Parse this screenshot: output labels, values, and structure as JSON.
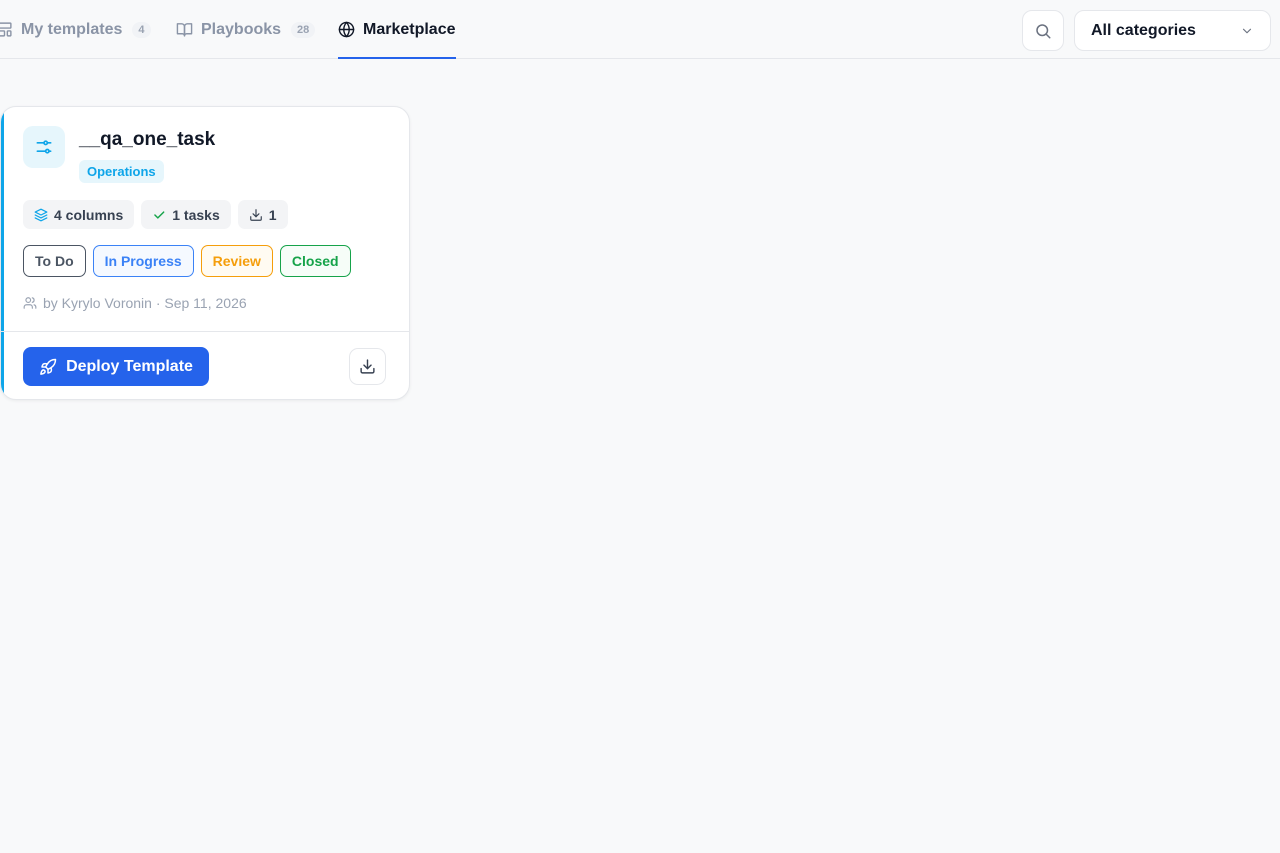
{
  "tabs": [
    {
      "label": "My templates",
      "count": "4",
      "icon": "layout-template-icon"
    },
    {
      "label": "Playbooks",
      "count": "28",
      "icon": "book-open-icon"
    },
    {
      "label": "Marketplace",
      "icon": "globe-icon",
      "active": true
    }
  ],
  "toolbar": {
    "search_icon": "search-icon",
    "category_select": {
      "value": "All categories",
      "icon": "chevron-down-icon"
    }
  },
  "card": {
    "title": "__qa_one_task",
    "icon": "sliders-icon",
    "category": "Operations",
    "accent_color": "#0ea5e9",
    "stats": [
      {
        "label": "4 columns",
        "icon": "layers-icon"
      },
      {
        "label": "1 tasks",
        "icon": "check-icon"
      },
      {
        "label": "1",
        "icon": "download-icon"
      }
    ],
    "columns": [
      {
        "label": "To Do",
        "color": "#4b5563"
      },
      {
        "label": "In Progress",
        "color": "#3b82f6"
      },
      {
        "label": "Review",
        "color": "#f59e0b"
      },
      {
        "label": "Closed",
        "color": "#16a34a"
      }
    ],
    "meta": "by Kyrylo Voronin · Sep 11, 2026",
    "deploy_label": "Deploy Template",
    "deploy_color": "#2563eb"
  }
}
